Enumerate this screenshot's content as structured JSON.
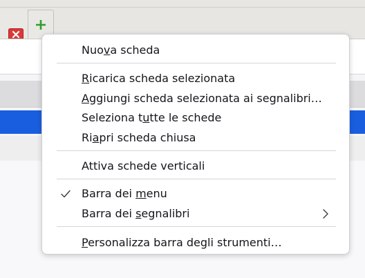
{
  "window": {
    "tab_close_icon": "close-icon",
    "new_tab_icon": "plus-icon",
    "colors": {
      "close": "#d93a3a",
      "new_tab_plus": "#2e9e2e",
      "selection": "#1a5ee0"
    }
  },
  "menu": {
    "items": [
      {
        "label_pre": "Nuo",
        "label_key": "v",
        "label_post": "a scheda"
      },
      {
        "label_pre": "",
        "label_key": "R",
        "label_post": "icarica scheda selezionata"
      },
      {
        "label_pre": "",
        "label_key": "A",
        "label_post": "ggiungi scheda selezionata ai segnalibri…"
      },
      {
        "label_pre": "Seleziona t",
        "label_key": "u",
        "label_post": "tte le schede"
      },
      {
        "label_pre": "Ri",
        "label_key": "a",
        "label_post": "pri scheda chiusa"
      },
      {
        "label_pre": "Attiva schede verticali",
        "label_key": "",
        "label_post": ""
      },
      {
        "label_pre": "Barra dei ",
        "label_key": "m",
        "label_post": "enu",
        "checked": true,
        "icon": "checkmark-icon"
      },
      {
        "label_pre": "Barra dei ",
        "label_key": "s",
        "label_post": "egnalibri",
        "submenu": true,
        "icon": "chevron-right-icon"
      },
      {
        "label_pre": "",
        "label_key": "P",
        "label_post": "ersonalizza barra degli strumenti…"
      }
    ]
  }
}
